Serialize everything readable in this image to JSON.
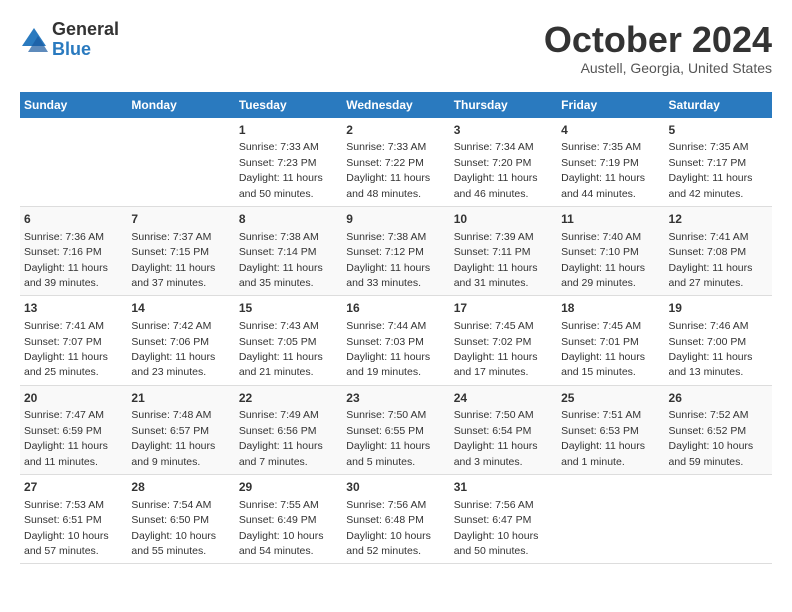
{
  "logo": {
    "general": "General",
    "blue": "Blue"
  },
  "title": "October 2024",
  "location": "Austell, Georgia, United States",
  "days_of_week": [
    "Sunday",
    "Monday",
    "Tuesday",
    "Wednesday",
    "Thursday",
    "Friday",
    "Saturday"
  ],
  "weeks": [
    [
      {
        "day": "",
        "info": ""
      },
      {
        "day": "",
        "info": ""
      },
      {
        "day": "1",
        "info": "Sunrise: 7:33 AM\nSunset: 7:23 PM\nDaylight: 11 hours and 50 minutes."
      },
      {
        "day": "2",
        "info": "Sunrise: 7:33 AM\nSunset: 7:22 PM\nDaylight: 11 hours and 48 minutes."
      },
      {
        "day": "3",
        "info": "Sunrise: 7:34 AM\nSunset: 7:20 PM\nDaylight: 11 hours and 46 minutes."
      },
      {
        "day": "4",
        "info": "Sunrise: 7:35 AM\nSunset: 7:19 PM\nDaylight: 11 hours and 44 minutes."
      },
      {
        "day": "5",
        "info": "Sunrise: 7:35 AM\nSunset: 7:17 PM\nDaylight: 11 hours and 42 minutes."
      }
    ],
    [
      {
        "day": "6",
        "info": "Sunrise: 7:36 AM\nSunset: 7:16 PM\nDaylight: 11 hours and 39 minutes."
      },
      {
        "day": "7",
        "info": "Sunrise: 7:37 AM\nSunset: 7:15 PM\nDaylight: 11 hours and 37 minutes."
      },
      {
        "day": "8",
        "info": "Sunrise: 7:38 AM\nSunset: 7:14 PM\nDaylight: 11 hours and 35 minutes."
      },
      {
        "day": "9",
        "info": "Sunrise: 7:38 AM\nSunset: 7:12 PM\nDaylight: 11 hours and 33 minutes."
      },
      {
        "day": "10",
        "info": "Sunrise: 7:39 AM\nSunset: 7:11 PM\nDaylight: 11 hours and 31 minutes."
      },
      {
        "day": "11",
        "info": "Sunrise: 7:40 AM\nSunset: 7:10 PM\nDaylight: 11 hours and 29 minutes."
      },
      {
        "day": "12",
        "info": "Sunrise: 7:41 AM\nSunset: 7:08 PM\nDaylight: 11 hours and 27 minutes."
      }
    ],
    [
      {
        "day": "13",
        "info": "Sunrise: 7:41 AM\nSunset: 7:07 PM\nDaylight: 11 hours and 25 minutes."
      },
      {
        "day": "14",
        "info": "Sunrise: 7:42 AM\nSunset: 7:06 PM\nDaylight: 11 hours and 23 minutes."
      },
      {
        "day": "15",
        "info": "Sunrise: 7:43 AM\nSunset: 7:05 PM\nDaylight: 11 hours and 21 minutes."
      },
      {
        "day": "16",
        "info": "Sunrise: 7:44 AM\nSunset: 7:03 PM\nDaylight: 11 hours and 19 minutes."
      },
      {
        "day": "17",
        "info": "Sunrise: 7:45 AM\nSunset: 7:02 PM\nDaylight: 11 hours and 17 minutes."
      },
      {
        "day": "18",
        "info": "Sunrise: 7:45 AM\nSunset: 7:01 PM\nDaylight: 11 hours and 15 minutes."
      },
      {
        "day": "19",
        "info": "Sunrise: 7:46 AM\nSunset: 7:00 PM\nDaylight: 11 hours and 13 minutes."
      }
    ],
    [
      {
        "day": "20",
        "info": "Sunrise: 7:47 AM\nSunset: 6:59 PM\nDaylight: 11 hours and 11 minutes."
      },
      {
        "day": "21",
        "info": "Sunrise: 7:48 AM\nSunset: 6:57 PM\nDaylight: 11 hours and 9 minutes."
      },
      {
        "day": "22",
        "info": "Sunrise: 7:49 AM\nSunset: 6:56 PM\nDaylight: 11 hours and 7 minutes."
      },
      {
        "day": "23",
        "info": "Sunrise: 7:50 AM\nSunset: 6:55 PM\nDaylight: 11 hours and 5 minutes."
      },
      {
        "day": "24",
        "info": "Sunrise: 7:50 AM\nSunset: 6:54 PM\nDaylight: 11 hours and 3 minutes."
      },
      {
        "day": "25",
        "info": "Sunrise: 7:51 AM\nSunset: 6:53 PM\nDaylight: 11 hours and 1 minute."
      },
      {
        "day": "26",
        "info": "Sunrise: 7:52 AM\nSunset: 6:52 PM\nDaylight: 10 hours and 59 minutes."
      }
    ],
    [
      {
        "day": "27",
        "info": "Sunrise: 7:53 AM\nSunset: 6:51 PM\nDaylight: 10 hours and 57 minutes."
      },
      {
        "day": "28",
        "info": "Sunrise: 7:54 AM\nSunset: 6:50 PM\nDaylight: 10 hours and 55 minutes."
      },
      {
        "day": "29",
        "info": "Sunrise: 7:55 AM\nSunset: 6:49 PM\nDaylight: 10 hours and 54 minutes."
      },
      {
        "day": "30",
        "info": "Sunrise: 7:56 AM\nSunset: 6:48 PM\nDaylight: 10 hours and 52 minutes."
      },
      {
        "day": "31",
        "info": "Sunrise: 7:56 AM\nSunset: 6:47 PM\nDaylight: 10 hours and 50 minutes."
      },
      {
        "day": "",
        "info": ""
      },
      {
        "day": "",
        "info": ""
      }
    ]
  ]
}
